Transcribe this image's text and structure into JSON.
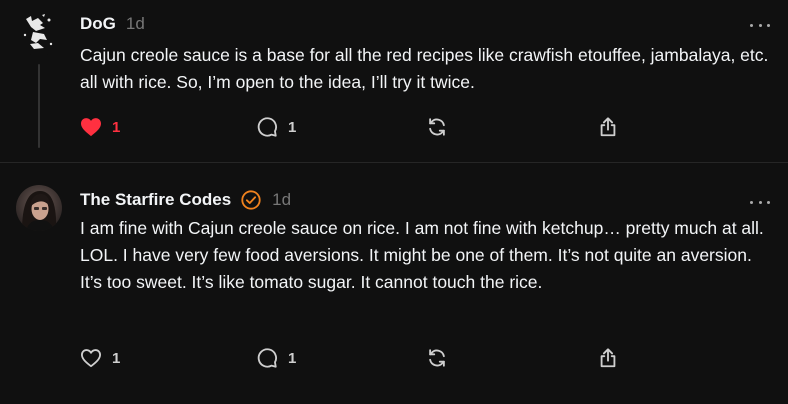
{
  "posts": [
    {
      "username": "DoG",
      "time": "1d",
      "text": "Cajun creole sauce is a base for all the red recipes like crawfish etouffee, jambalaya, etc. all with rice. So, I’m open to the idea, I’ll try it twice.",
      "likes": "1",
      "liked": true,
      "replies": "1",
      "verified": false
    },
    {
      "username": "The Starfire Codes",
      "time": "1d",
      "text": "I am fine with Cajun creole sauce on rice. I am not fine with ketchup… pretty much at all. LOL. I have very few food aversions. It might be one of them. It’s not quite an aversion. It’s too sweet. It’s like tomato sugar. It cannot touch the rice.",
      "likes": "1",
      "liked": false,
      "replies": "1",
      "verified": true
    }
  ],
  "colors": {
    "background": "#101010",
    "liked": "#ff3040",
    "verified_badge": "#f0821e",
    "muted_text": "#777777"
  },
  "icons": [
    "heart-icon",
    "reply-bubble-icon",
    "repost-icon",
    "share-icon",
    "more-options-icon",
    "verified-badge-icon"
  ]
}
